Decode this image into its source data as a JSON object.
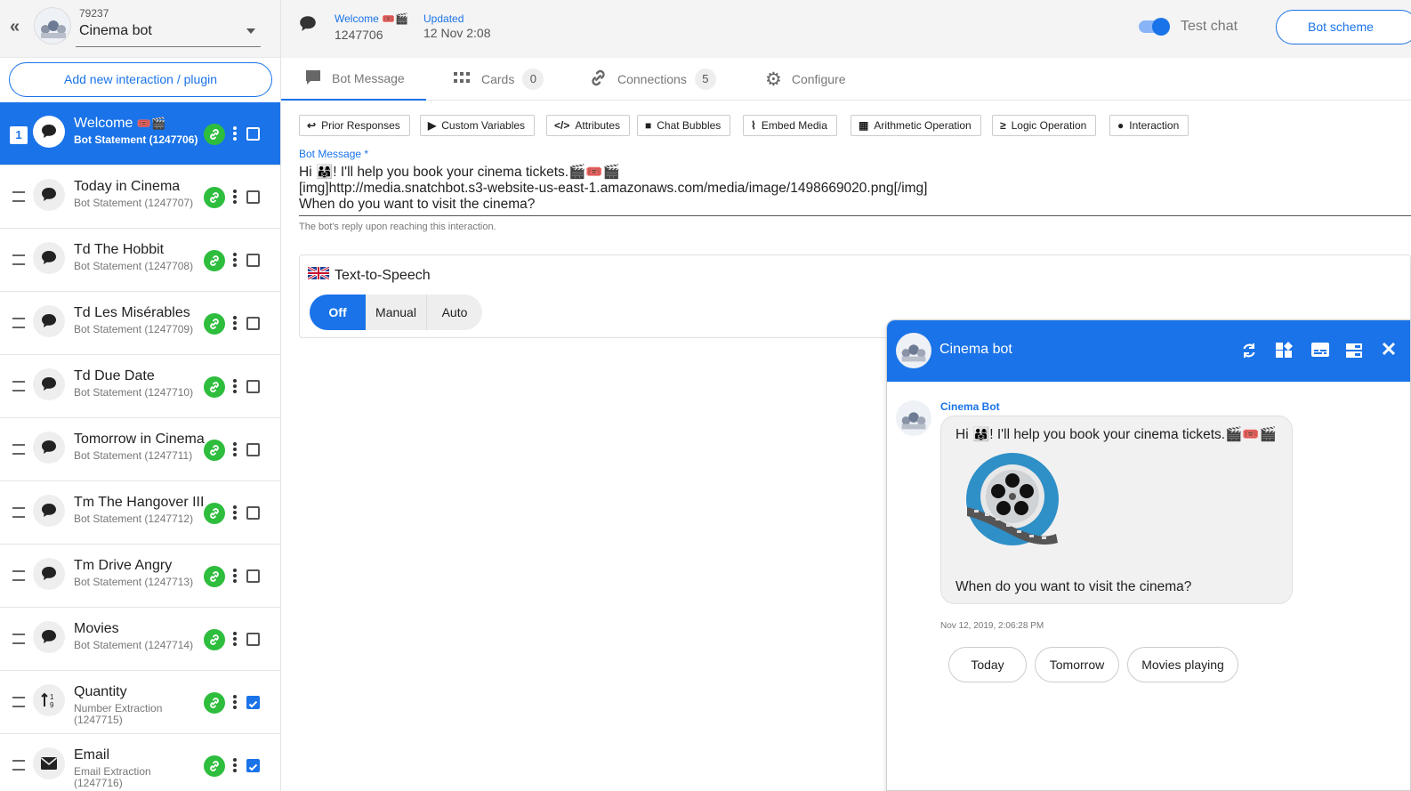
{
  "bot": {
    "id": "79237",
    "name": "Cinema bot"
  },
  "sidebar": {
    "add_label": "Add new interaction / plugin",
    "items": [
      {
        "num": "1",
        "title": "Welcome",
        "emoji": "🎟️🎬",
        "sub": "Bot Statement (1247706)",
        "checked": false
      },
      {
        "title": "Today in Cinema",
        "sub": "Bot Statement (1247707)",
        "checked": false
      },
      {
        "title": "Td The Hobbit",
        "sub": "Bot Statement (1247708)",
        "checked": false
      },
      {
        "title": "Td Les Misérables",
        "sub": "Bot Statement (1247709)",
        "checked": false
      },
      {
        "title": "Td Due Date",
        "sub": "Bot Statement (1247710)",
        "checked": false
      },
      {
        "title": "Tomorrow in Cinema",
        "sub": "Bot Statement (1247711)",
        "checked": false
      },
      {
        "title": "Tm The Hangover III",
        "sub": "Bot Statement (1247712)",
        "checked": false
      },
      {
        "title": "Tm Drive Angry",
        "sub": "Bot Statement (1247713)",
        "checked": false
      },
      {
        "title": "Movies",
        "sub": "Bot Statement (1247714)",
        "checked": false
      },
      {
        "title": "Quantity",
        "sub": "Number Extraction (1247715)",
        "checked": true
      },
      {
        "title": "Email",
        "sub": "Email Extraction (1247716)",
        "checked": true
      }
    ]
  },
  "header": {
    "interaction_name": "Welcome 🎟️🎬",
    "interaction_id": "1247706",
    "updated_label": "Updated",
    "updated_value": "12 Nov 2:08",
    "test_chat_label": "Test chat",
    "bot_scheme_label": "Bot scheme"
  },
  "tabs": [
    {
      "label": "Bot Message",
      "icon": "comment-icon"
    },
    {
      "label": "Cards",
      "count": "0",
      "icon": "grid-icon"
    },
    {
      "label": "Connections",
      "count": "5",
      "icon": "link-icon"
    },
    {
      "label": "Configure",
      "icon": "gear-icon"
    }
  ],
  "toolbar": [
    "Prior Responses",
    "Custom Variables",
    "Attributes",
    "Chat Bubbles",
    "Embed Media",
    "Arithmetic Operation",
    "Logic Operation",
    "Interaction"
  ],
  "editor": {
    "label": "Bot Message *",
    "lines": [
      "Hi 👨‍👩‍👧! I'll help you book your cinema tickets.🎬🎟️🎬",
      "[img]http://media.snatchbot.s3-website-us-east-1.amazonaws.com/media/image/1498669020.png[/img]",
      "When do you want to visit the cinema?"
    ],
    "hint": "The bot's reply upon reaching this interaction."
  },
  "tts": {
    "title": "Text-to-Speech",
    "options": [
      "Off",
      "Manual",
      "Auto"
    ],
    "selected": "Off"
  },
  "chat": {
    "title": "Cinema bot",
    "sender": "Cinema Bot",
    "line1": "Hi 👨‍👩‍👧! I'll help you book your cinema tickets.🎬🎟️🎬",
    "line2": "When do you want to visit the cinema?",
    "timestamp": "Nov 12, 2019, 2:06:28 PM",
    "quick_replies": [
      "Today",
      "Tomorrow",
      "Movies playing"
    ]
  },
  "colors": {
    "accent": "#1a73e8",
    "link_green": "#2ebd3d"
  }
}
